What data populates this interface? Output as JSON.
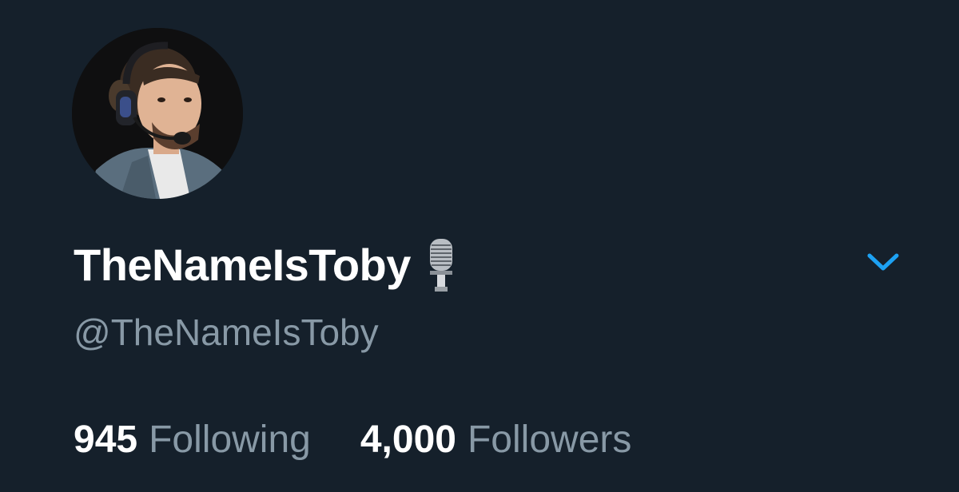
{
  "profile": {
    "display_name": "TheNameIsToby",
    "display_name_icon": "studio-microphone-icon",
    "handle": "@TheNameIsToby",
    "menu_icon": "chevron-down-icon",
    "following_count": "945",
    "following_label": "Following",
    "followers_count": "4,000",
    "followers_label": "Followers"
  },
  "colors": {
    "background": "#15202b",
    "primary_text": "#ffffff",
    "secondary_text": "#8899a6",
    "accent": "#1da1f2"
  }
}
